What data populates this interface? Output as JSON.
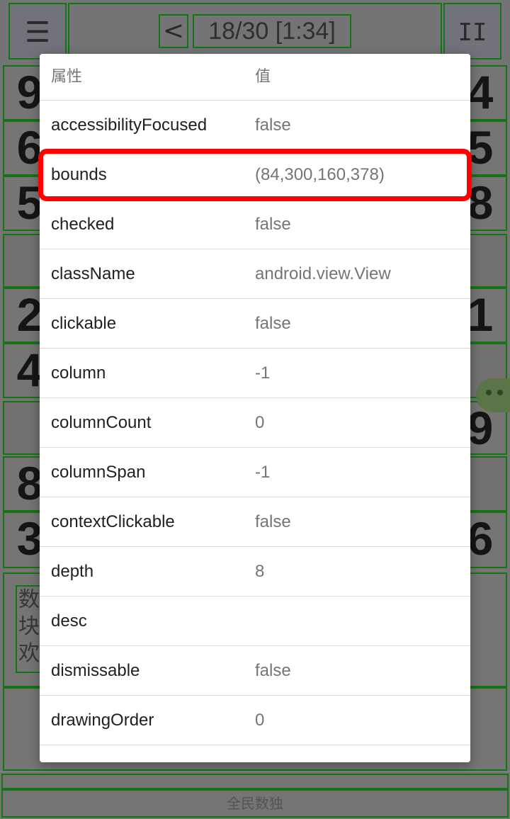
{
  "background_app": {
    "menu_icon": "hamburger-menu-icon",
    "prev_label": "<",
    "progress_label": "18/30 [1:34]",
    "pause_icon": "pause-icon",
    "grid_cells_visible_left": [
      "9",
      "6",
      "5",
      "2",
      "4",
      "8",
      "3"
    ],
    "grid_cells_visible_right": [
      "4",
      "5",
      "8",
      "1",
      "9",
      "6"
    ],
    "message_chars": [
      "数",
      "块",
      "欢"
    ],
    "footer_label": "全民数独"
  },
  "dialog": {
    "header": {
      "key_label": "属性",
      "value_label": "值"
    },
    "rows": [
      {
        "key": "accessibilityFocused",
        "value": "false"
      },
      {
        "key": "bounds",
        "value": "(84,300,160,378)"
      },
      {
        "key": "checked",
        "value": "false"
      },
      {
        "key": "className",
        "value": "android.view.View"
      },
      {
        "key": "clickable",
        "value": "false"
      },
      {
        "key": "column",
        "value": "-1"
      },
      {
        "key": "columnCount",
        "value": "0"
      },
      {
        "key": "columnSpan",
        "value": "-1"
      },
      {
        "key": "contextClickable",
        "value": "false"
      },
      {
        "key": "depth",
        "value": "8"
      },
      {
        "key": "desc",
        "value": ""
      },
      {
        "key": "dismissable",
        "value": "false"
      },
      {
        "key": "drawingOrder",
        "value": "0"
      }
    ],
    "highlighted_row": "bounds"
  },
  "colors": {
    "highlight": "#ff0000",
    "outline": "#1a8f1a",
    "dialog_bg": "#ffffff",
    "key_text": "#212121",
    "value_text": "#757575"
  }
}
